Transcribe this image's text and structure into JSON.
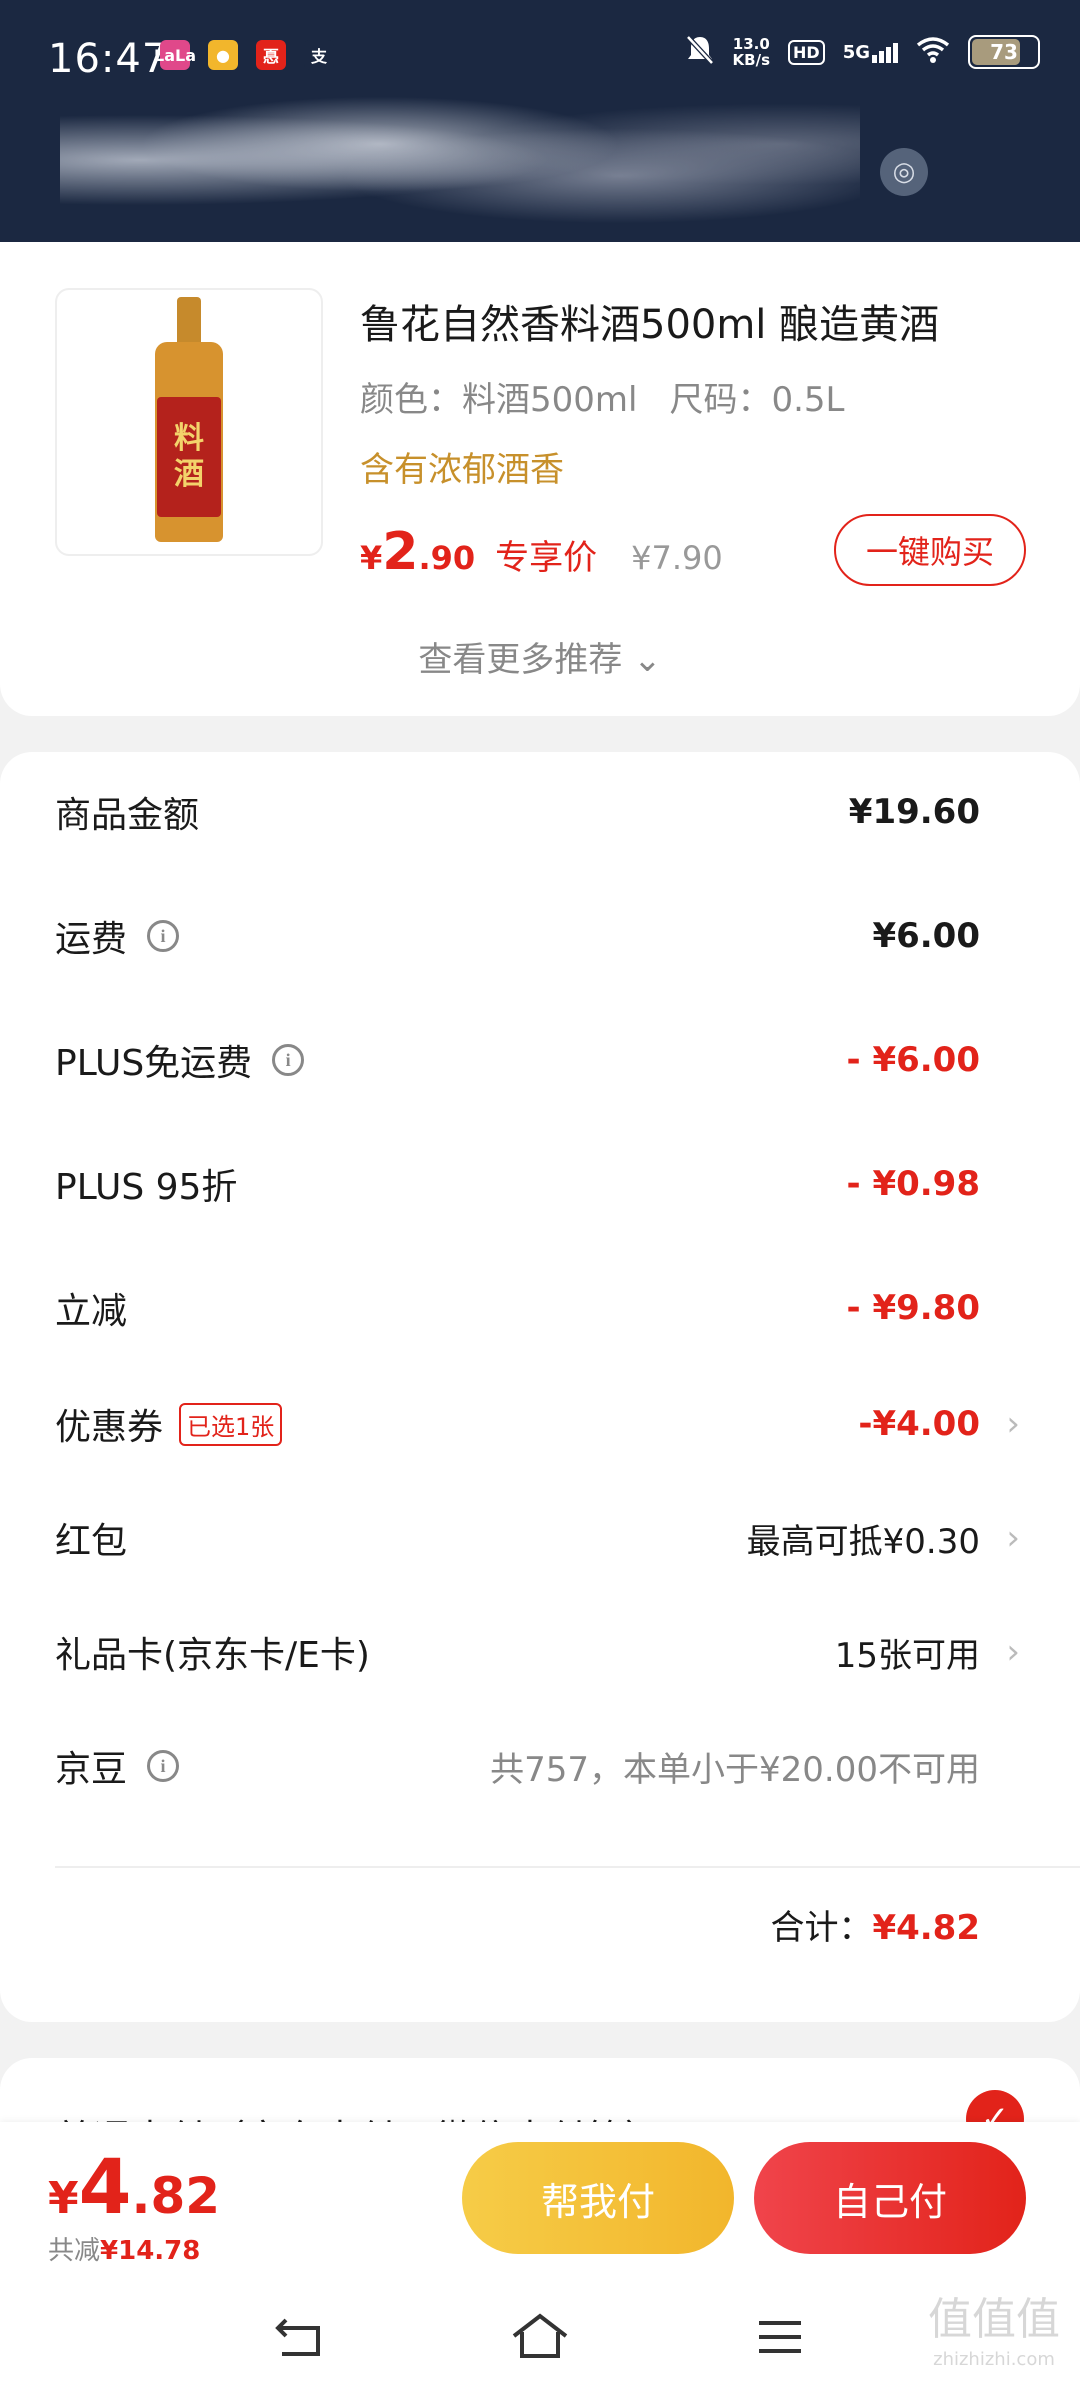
{
  "status_bar": {
    "time": "16:47",
    "notif_icons": [
      {
        "name": "lala-app-icon",
        "color": "#e0488a",
        "text": "LaLa"
      },
      {
        "name": "face-app-icon",
        "color": "#f2b62c",
        "text": "●"
      },
      {
        "name": "cheat-app-icon",
        "color": "#e2231a",
        "text": "㥑"
      },
      {
        "name": "alipay-icon",
        "color": "#1b2841",
        "text": "支"
      }
    ],
    "net_speed": "13.0",
    "net_unit": "KB/s",
    "hd": "HD",
    "signal": "5G",
    "battery": "73"
  },
  "product": {
    "title": "鲁花自然香料酒500ml 酿造黄酒",
    "spec_color": "颜色：料酒500ml",
    "spec_size": "尺码：0.5L",
    "tag": "含有浓郁酒香",
    "price_cur": "¥",
    "price_int": "2",
    "price_dec": ".90",
    "price_label": "专享价",
    "orig_price": "¥7.90",
    "buy_label": "一键购买",
    "bottle_text": "料\n酒",
    "more_label": "查看更多推荐 ⌄"
  },
  "amounts": [
    {
      "label": "商品金额",
      "value": "¥19.60",
      "style": "bold",
      "info": false,
      "chevron": false
    },
    {
      "label": "运费",
      "value": "¥6.00",
      "style": "bold",
      "info": true,
      "chevron": false
    },
    {
      "label": "PLUS免运费",
      "value": "- ¥6.00",
      "style": "red",
      "info": true,
      "chevron": false
    },
    {
      "label": "PLUS 95折",
      "value": "- ¥0.98",
      "style": "red",
      "info": false,
      "chevron": false
    },
    {
      "label": "立减",
      "value": "- ¥9.80",
      "style": "red",
      "info": false,
      "chevron": false
    },
    {
      "label": "优惠券",
      "value": "-¥4.00",
      "style": "red",
      "info": false,
      "chevron": true,
      "badge": "已选1张"
    },
    {
      "label": "红包",
      "value": "最高可抵¥0.30",
      "style": "normal",
      "info": false,
      "chevron": true
    },
    {
      "label": "礼品卡(京东卡/E卡)",
      "value": "15张可用",
      "style": "normal",
      "info": false,
      "chevron": true
    },
    {
      "label": "京豆",
      "value": "共757，本单小于¥20.00不可用",
      "style": "gray",
      "info": true,
      "chevron": false
    }
  ],
  "total": {
    "label": "合计：",
    "value": "¥4.82"
  },
  "payment": {
    "label": "普通支付（京东支付、微信支付等）"
  },
  "bottom": {
    "cur": "¥",
    "int": "4",
    "dec": ".82",
    "saved_label": "共减",
    "saved_value": "¥14.78",
    "help_pay": "帮我付",
    "self_pay": "自己付"
  },
  "watermark": {
    "main": "值值值",
    "sub": "zhizhizhi.com"
  }
}
